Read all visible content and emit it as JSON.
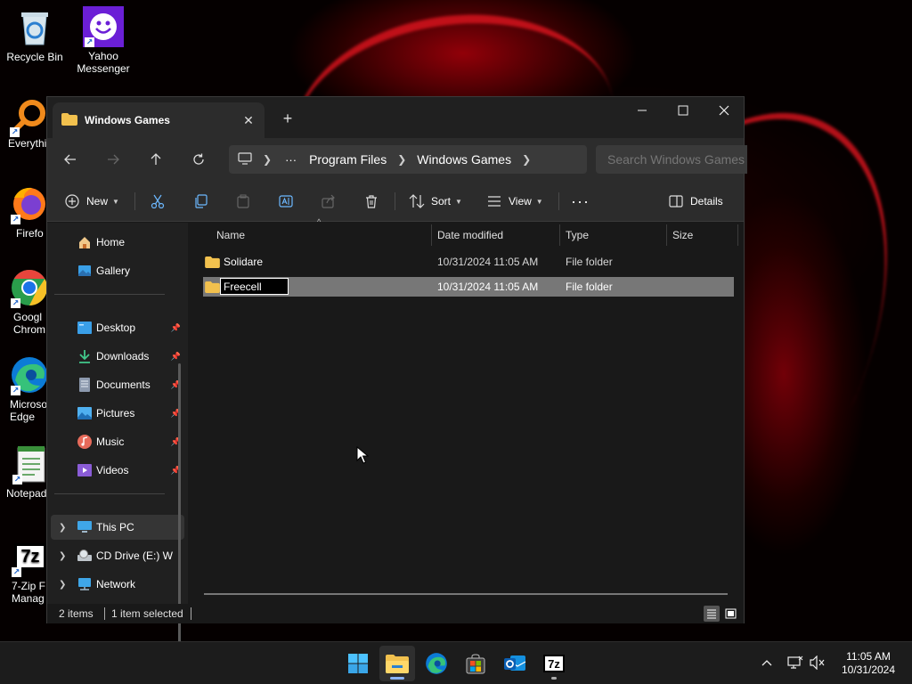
{
  "desktop": {
    "icons": [
      {
        "label_lines": [
          "Recycle Bin"
        ],
        "icon": "recycle-bin-icon"
      },
      {
        "label_lines": [
          "Yahoo",
          "Messenger"
        ],
        "icon": "yahoo-messenger-icon"
      },
      {
        "label_lines": [
          "Everythi"
        ],
        "icon": "everything-search-icon"
      },
      {
        "label_lines": [
          "Firefo"
        ],
        "icon": "firefox-icon"
      },
      {
        "label_lines": [
          "Googl",
          "Chrom"
        ],
        "icon": "chrome-icon"
      },
      {
        "label_lines": [
          "Microso",
          "Edge"
        ],
        "icon": "edge-icon"
      },
      {
        "label_lines": [
          "Notepad"
        ],
        "icon": "notepad-icon"
      },
      {
        "label_lines": [
          "7-Zip F",
          "Manag"
        ],
        "icon": "7zip-icon"
      }
    ]
  },
  "window": {
    "tab_title": "Windows Games",
    "search_placeholder": "Search Windows Games",
    "breadcrumbs": [
      "Program Files",
      "Windows Games"
    ],
    "toolbar": {
      "new_label": "New",
      "sort_label": "Sort",
      "view_label": "View",
      "details_label": "Details"
    },
    "sidebar": {
      "top_items": [
        {
          "label": "Home",
          "icon": "home-icon"
        },
        {
          "label": "Gallery",
          "icon": "gallery-icon"
        }
      ],
      "quick_access": [
        {
          "label": "Desktop",
          "icon": "desktop-folder-icon"
        },
        {
          "label": "Downloads",
          "icon": "downloads-icon"
        },
        {
          "label": "Documents",
          "icon": "documents-icon"
        },
        {
          "label": "Pictures",
          "icon": "pictures-icon"
        },
        {
          "label": "Music",
          "icon": "music-icon"
        },
        {
          "label": "Videos",
          "icon": "videos-icon"
        }
      ],
      "drives": [
        {
          "label": "This PC",
          "icon": "this-pc-icon"
        },
        {
          "label": "CD Drive (E:) WI",
          "icon": "cd-drive-icon"
        },
        {
          "label": "Network",
          "icon": "network-icon"
        }
      ]
    },
    "columns": [
      "Name",
      "Date modified",
      "Type",
      "Size"
    ],
    "files": [
      {
        "name": "Solidare",
        "date": "10/31/2024 11:05 AM",
        "type": "File folder",
        "size": ""
      },
      {
        "name": "Freecell",
        "date": "10/31/2024 11:05 AM",
        "type": "File folder",
        "size": "",
        "renaming": true
      }
    ],
    "status": {
      "item_count": "2 items",
      "selection": "1 item selected"
    }
  },
  "taskbar": {
    "time": "11:05 AM",
    "date": "10/31/2024"
  },
  "colors": {
    "accent": "#4cc2ff",
    "folder": "#f2c14e",
    "selection": "#777777"
  }
}
